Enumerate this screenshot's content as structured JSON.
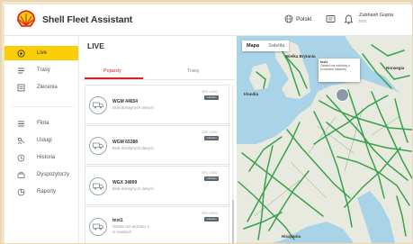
{
  "app": {
    "title": "Shell Fleet Assistant"
  },
  "header": {
    "language": "Polski",
    "user_name": "Zubhash Gupta",
    "user_sub": "test"
  },
  "sidebar": {
    "items": [
      {
        "label": "Live",
        "icon": "live-icon",
        "active": true
      },
      {
        "label": "Trasy",
        "icon": "route-icon"
      },
      {
        "label": "Zlecenia",
        "icon": "orders-icon"
      },
      {
        "label": "Flota",
        "icon": "fleet-icon"
      },
      {
        "label": "Usługi",
        "icon": "services-icon"
      },
      {
        "label": "Historia",
        "icon": "history-icon"
      },
      {
        "label": "Dyspozytorzy",
        "icon": "dispatchers-icon"
      },
      {
        "label": "Raporty",
        "icon": "reports-icon"
      }
    ]
  },
  "main": {
    "title": "LIVE",
    "tabs": [
      {
        "label": "Pojazdy"
      },
      {
        "label": "Trasy"
      }
    ],
    "vehicles": [
      {
        "plate": "WGM 44654",
        "status": "Brak dostępnych danych",
        "time": "BFS 19402",
        "badge": "unknown"
      },
      {
        "plate": "WGM 65388",
        "status": "Brak dostępnych danych",
        "time": "BFS 19402",
        "badge": "unknown"
      },
      {
        "plate": "WGX 34899",
        "status": "Brak dostępnych danych",
        "time": "BFS 19402",
        "badge": "unknown"
      },
      {
        "plate": "test1",
        "status": "Ostatni raz widziany o",
        "sub": "w miastach",
        "time": "BFS 19402",
        "badge": "unknown"
      }
    ]
  },
  "map": {
    "type_options": [
      "Mapa",
      "Satelita"
    ],
    "popup": {
      "title": "test1",
      "line1": "Ostatni raz widziany o",
      "line2": "w mieście ostatniej"
    },
    "labels": [
      "Wielka Brytania",
      "Irlandia",
      "Norwegia",
      "Hiszpania"
    ],
    "colors": {
      "land": "#e8eadf",
      "water": "#a9d3e6",
      "roads": "#2f9e44",
      "accent": "#fbce07",
      "red": "#dd1d21"
    }
  }
}
